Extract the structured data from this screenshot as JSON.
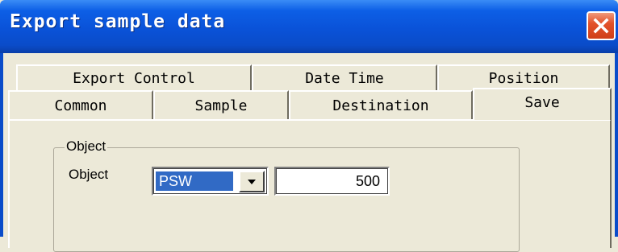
{
  "window": {
    "title": "Export sample data"
  },
  "tabs": {
    "row1": [
      {
        "label": "Export Control"
      },
      {
        "label": "Date Time"
      },
      {
        "label": "Position"
      }
    ],
    "row2": [
      {
        "label": "Common"
      },
      {
        "label": "Sample"
      },
      {
        "label": "Destination"
      },
      {
        "label": "Save",
        "active": true
      }
    ]
  },
  "group": {
    "legend": "Object",
    "object_label": "Object",
    "object_select": "PSW",
    "object_value": "500"
  },
  "colors": {
    "titlebar": "#0a52d8",
    "close": "#e3522b",
    "face": "#ece9d8",
    "selection": "#316ac5"
  }
}
